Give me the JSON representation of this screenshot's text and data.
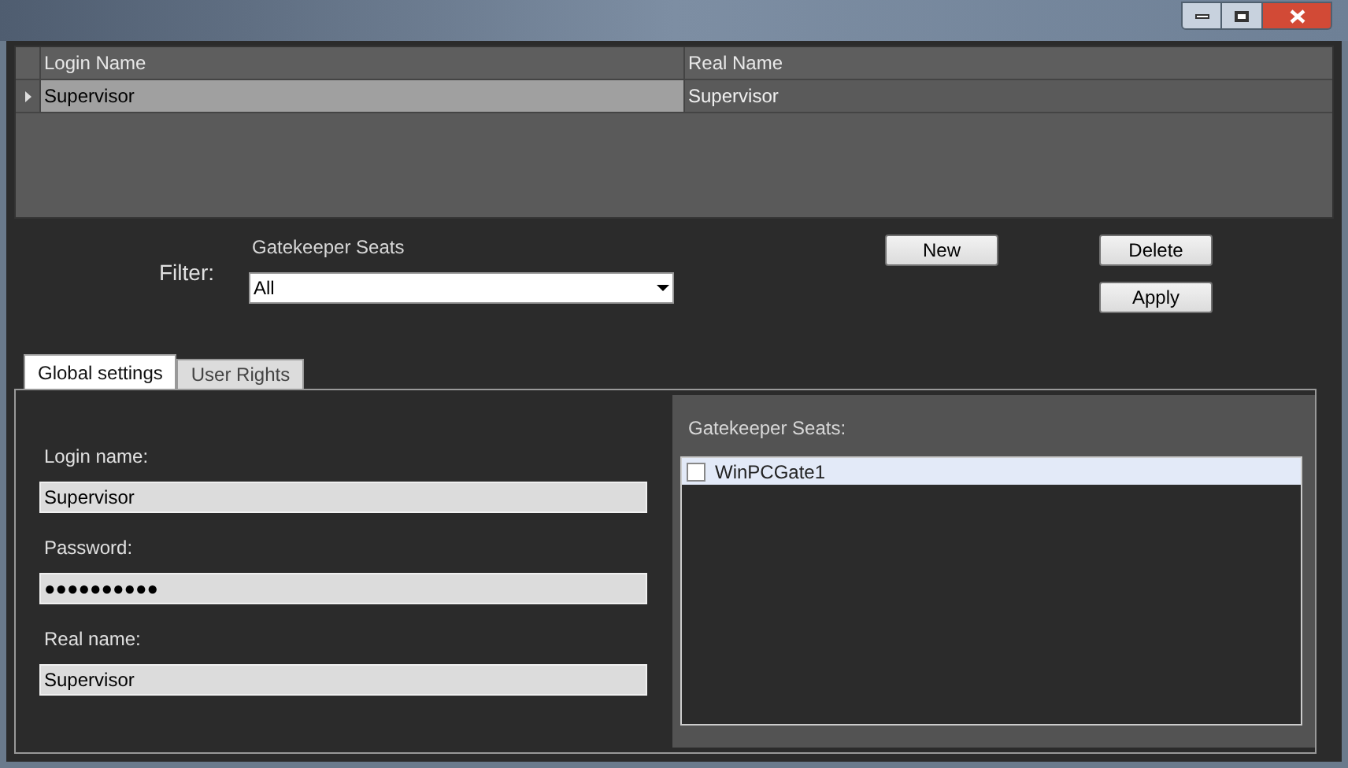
{
  "table": {
    "columns": [
      "Login Name",
      "Real Name"
    ],
    "rows": [
      {
        "selected": true,
        "cells": [
          "Supervisor",
          "Supervisor"
        ]
      }
    ]
  },
  "filter": {
    "label": "Filter:",
    "caption": "Gatekeeper Seats",
    "value": "All"
  },
  "buttons": [
    "New",
    "Delete",
    "Apply"
  ],
  "tabs": [
    {
      "label": "Global settings",
      "selected": true
    },
    {
      "label": "User Rights",
      "selected": false
    }
  ],
  "fields": [
    {
      "label": "Login name:",
      "value": "Supervisor"
    },
    {
      "label": "Password:",
      "value": "●●●●●●●●●●"
    },
    {
      "label": "Real name:",
      "value": "Supervisor"
    }
  ],
  "seats": {
    "title": "Gatekeeper Seats:",
    "items": [
      {
        "label": "WinPCGate1",
        "checked": false,
        "selected": true
      }
    ]
  }
}
